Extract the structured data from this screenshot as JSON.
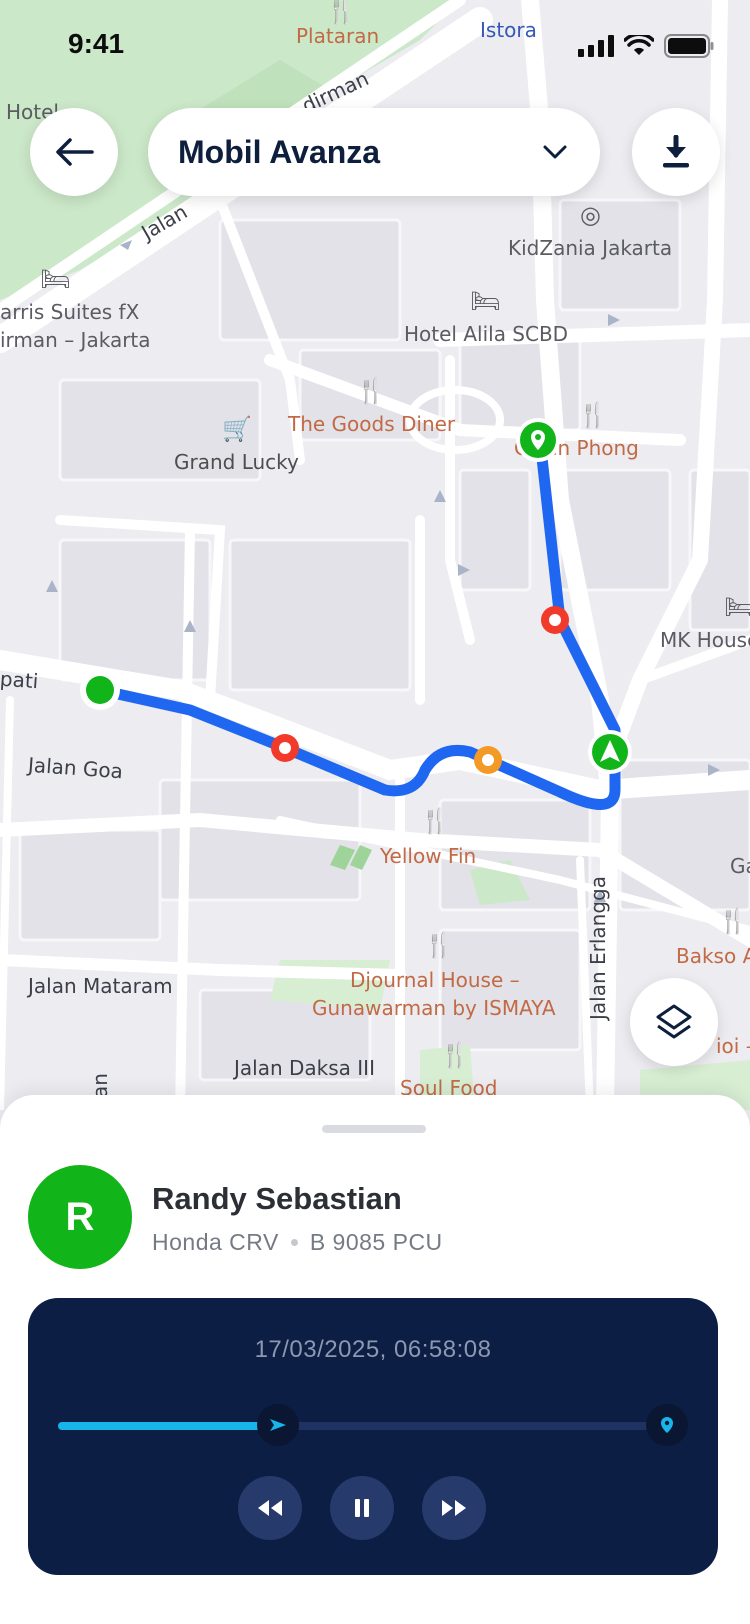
{
  "status_bar": {
    "time": "9:41"
  },
  "header": {
    "back_icon": "arrow-left-icon",
    "vehicle_select": {
      "value": "Mobil Avanza",
      "icon": "chevron-down-icon"
    },
    "download_icon": "download-icon"
  },
  "map": {
    "pois": {
      "plataran": "Plataran",
      "istora": "Istora",
      "hotel": "Hotel",
      "kidzania": "KidZania Jakarta",
      "harris": "arris Suites fX",
      "harris2": "irman – Jakarta",
      "alila": "Hotel Alila SCBD",
      "goods_diner": "The Goods Diner",
      "grand_lucky": "Grand Lucky",
      "chicken_phong": "C    ken Phong",
      "mk_house": "MK House",
      "yellow_fin": "Yellow Fin",
      "djournal1": "Djournal House –",
      "djournal2": "Gunawarman by ISMAYA",
      "soul_food": "Soul Food",
      "bakso": "Bakso A",
      "ga": "Ga",
      "bioi": "ioi –"
    },
    "roads": {
      "jalan_top": "Jalan",
      "sudirman": "dirman",
      "pati": "pati",
      "jalan_goa": "Jalan Goa",
      "jalan_mataram": "Jalan Mataram",
      "jalan_daksa": "Jalan Daksa III",
      "jalan_erlangga": "Jalan Erlangga",
      "an": "an"
    },
    "route_color": "#1f67f0",
    "layers_icon": "layers-icon"
  },
  "sheet": {
    "avatar_initial": "R",
    "driver_name": "Randy Sebastian",
    "vehicle_model": "Honda CRV",
    "plate": "B 9085 PCU",
    "player": {
      "timestamp": "17/03/2025, 06:58:08",
      "progress_percent": 36,
      "controls": [
        "rewind-icon",
        "pause-icon",
        "fast-forward-icon"
      ]
    }
  },
  "colors": {
    "accent_green": "#11b51a",
    "player_bg": "#0c1e44",
    "progress": "#16b6ea",
    "stop_red": "#f23a2a",
    "stop_orange": "#f39a26"
  }
}
